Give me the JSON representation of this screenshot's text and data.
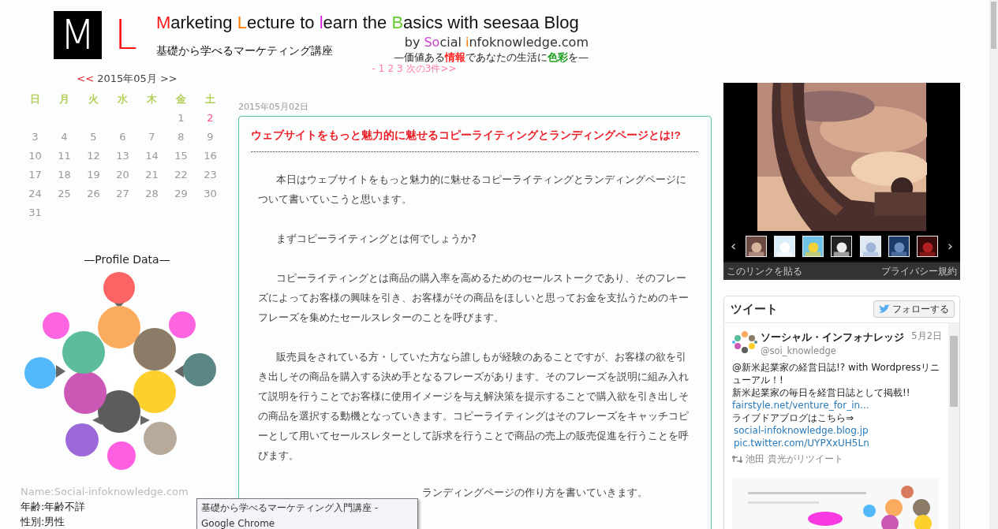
{
  "header": {
    "logo_letters": [
      "M",
      "L"
    ],
    "title": [
      {
        "text": "M",
        "color": "#ff1a1a"
      },
      {
        "text": "arketing "
      },
      {
        "text": "L",
        "color": "#ff7a00"
      },
      {
        "text": "ecture to "
      },
      {
        "text": "l",
        "color": "#e020e0"
      },
      {
        "text": "earn the "
      },
      {
        "text": "B",
        "color": "#66cc33"
      },
      {
        "text": "asics with seesaa Blog"
      }
    ],
    "subtitle": "基礎から学べるマーケティング講座",
    "byline": [
      {
        "text": "by "
      },
      {
        "text": "So",
        "color": "#d040d0"
      },
      {
        "text": "cial "
      },
      {
        "text": "i",
        "color": "#ff7a00"
      },
      {
        "text": "nfoknowledge.com"
      }
    ],
    "tagline": [
      {
        "text": "—価値ある"
      },
      {
        "text": "情報",
        "color": "#ff2020"
      },
      {
        "text": "であなたの生活に"
      },
      {
        "text": "色彩",
        "color": "#20a020"
      },
      {
        "text": "を—"
      }
    ]
  },
  "pager": {
    "items": [
      "-",
      "1",
      "2",
      "3"
    ],
    "next": "次の3件>>"
  },
  "calendar": {
    "prev": "<<",
    "month": "2015年05月",
    "next": ">>",
    "weekdays": [
      "日",
      "月",
      "火",
      "水",
      "木",
      "金",
      "土"
    ],
    "weeks": [
      [
        {
          "day": "1",
          "highlighted": false
        },
        {
          "day": "2",
          "highlighted": true
        }
      ],
      [
        {
          "day": "3",
          "highlighted": false
        },
        {
          "day": "4",
          "highlighted": false
        },
        {
          "day": "5",
          "highlighted": false
        },
        {
          "day": "6",
          "highlighted": false
        },
        {
          "day": "7",
          "highlighted": false
        },
        {
          "day": "8",
          "highlighted": false
        },
        {
          "day": "9",
          "highlighted": false
        }
      ],
      [
        {
          "day": "10",
          "highlighted": false
        },
        {
          "day": "11",
          "highlighted": false
        },
        {
          "day": "12",
          "highlighted": false
        },
        {
          "day": "13",
          "highlighted": false
        },
        {
          "day": "14",
          "highlighted": false
        },
        {
          "day": "15",
          "highlighted": false
        },
        {
          "day": "16",
          "highlighted": false
        }
      ],
      [
        {
          "day": "17",
          "highlighted": false
        },
        {
          "day": "18",
          "highlighted": false
        },
        {
          "day": "19",
          "highlighted": false
        },
        {
          "day": "20",
          "highlighted": false
        },
        {
          "day": "21",
          "highlighted": false
        },
        {
          "day": "22",
          "highlighted": false
        },
        {
          "day": "23",
          "highlighted": false
        }
      ],
      [
        {
          "day": "24",
          "highlighted": false
        },
        {
          "day": "25",
          "highlighted": false
        },
        {
          "day": "26",
          "highlighted": false
        },
        {
          "day": "27",
          "highlighted": false
        },
        {
          "day": "28",
          "highlighted": false
        },
        {
          "day": "29",
          "highlighted": false
        },
        {
          "day": "30",
          "highlighted": false
        }
      ],
      [
        {
          "day": "31",
          "highlighted": false
        }
      ]
    ]
  },
  "profile": {
    "title": "—Profile Data—",
    "diagram": {
      "kind": "picture"
    },
    "lines": [
      "Name:Social-infoknowledge.com",
      "年齢:年齢不詳",
      "性別:男性"
    ]
  },
  "article": {
    "date": "2015年05月02日",
    "title": "ウェブサイトをもっと魅力的に魅せるコピーライティングとランディングページとは!?",
    "paragraphs": [
      "本日はウェブサイトをもっと魅力的に魅せるコピーライティングとランディングページについて書いていこうと思います。",
      "まずコピーライティングとは何でしょうか?",
      "コピーライティングとは商品の購入率を高めるためのセールストークであり、そのフレーズによってお客様の興味を引き、お客様がその商品をほしいと思ってお金を支払うためのキーフレーズを集めたセールスレターのことを呼びます。",
      "販売員をされている方・していた方なら誰しもが経験のあることですが、お客様の欲を引き出しその商品を購入する決め手となるフレーズがあります。そのフレーズを説明に組み入れて説明を行うことでお客様に使用イメージを与え解決策を提示することで購入欲を引き出しその商品を選択する動機となっていきます。コピーライティングはそのフレーズをキャッチコピーとして用いてセールスレターとして訴求を行うことで商品の売上の販売促進を行うことを呼びます。"
    ],
    "covered_paragraph": "ランディングページの作り方を書いていきます。"
  },
  "slideshow": {
    "prev": "‹",
    "next": "›",
    "link": "このリンクを貼る",
    "privacy": "プライバシー規約"
  },
  "twitter": {
    "title": "ツイート",
    "follow": "フォローする",
    "tweet": {
      "name": "ソーシャル・インフォナレッジ",
      "handle": "@soi_knowledge",
      "date": "5月2日",
      "lines": [
        {
          "kind": "text",
          "text": "@新米起業家の経営日誌!? with Wordpressリニューアル！!"
        },
        {
          "kind": "text",
          "text": "新米起業家の毎日を経営日誌として掲載!!"
        },
        {
          "kind": "link",
          "text": "fairstyle.net/venture_for_in..."
        },
        {
          "kind": "text",
          "text": "ライブドアブログはこちら⇒"
        },
        {
          "kind": "link",
          "text": "social-infoknowledge.blog.jp"
        },
        {
          "kind": "link",
          "text": "pic.twitter.com/UYPXxUH5Ln"
        }
      ],
      "retweet": "池田 貴光がリツイート"
    }
  },
  "tooltip": {
    "text": "基礎から学べるマーケティング入門講座 - Google Chrome"
  }
}
